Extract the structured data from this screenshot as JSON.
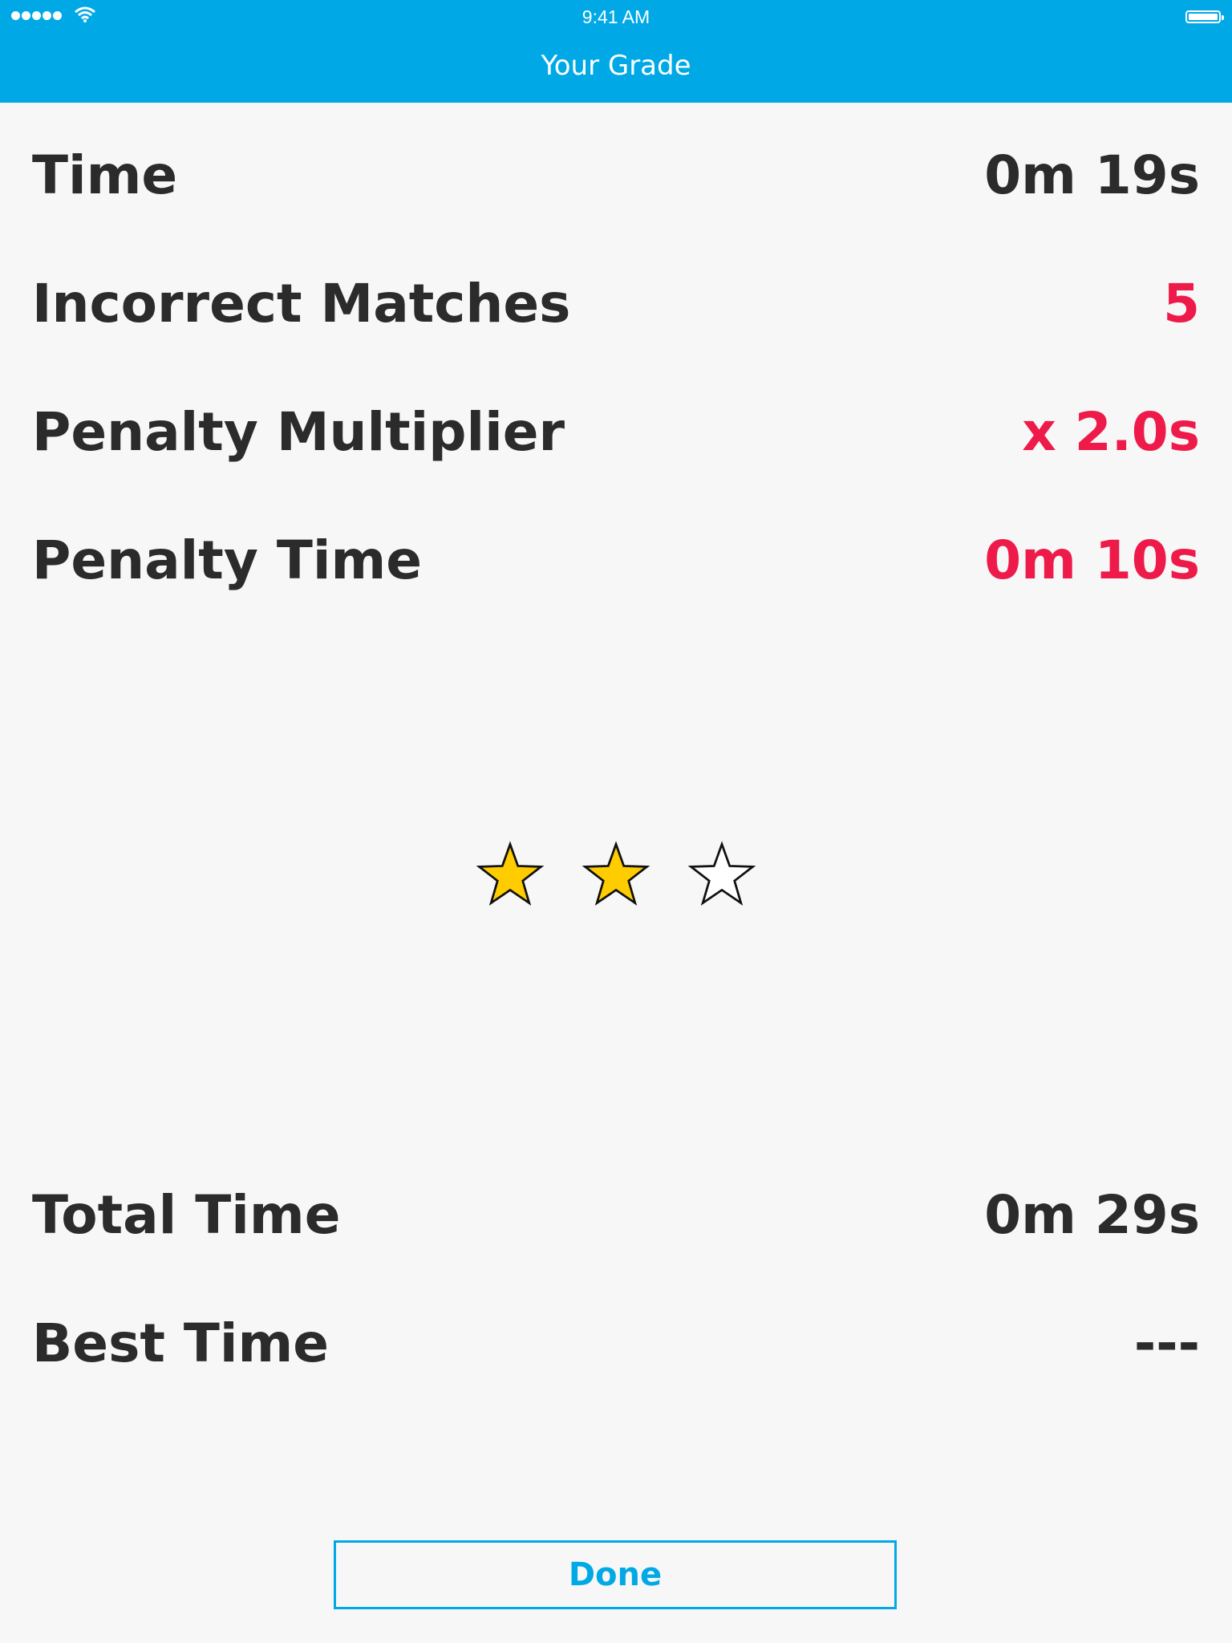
{
  "status_bar": {
    "time": "9:41 AM"
  },
  "nav": {
    "title": "Your Grade"
  },
  "stats": {
    "time": {
      "label": "Time",
      "value": "0m 19s"
    },
    "incorrect": {
      "label": "Incorrect Matches",
      "value": "5"
    },
    "multiplier": {
      "label": "Penalty Multiplier",
      "value": "x 2.0s"
    },
    "penalty": {
      "label": "Penalty Time",
      "value": "0m 10s"
    },
    "total": {
      "label": "Total Time",
      "value": "0m 29s"
    },
    "best": {
      "label": "Best Time",
      "value": "---"
    }
  },
  "rating": {
    "filled": 2,
    "max": 3,
    "filled_color": "#ffcc00"
  },
  "done_label": "Done",
  "colors": {
    "accent": "#00a9e6",
    "penalty": "#ee1a4a",
    "text": "#2b2b2b",
    "background": "#f7f7f7"
  }
}
